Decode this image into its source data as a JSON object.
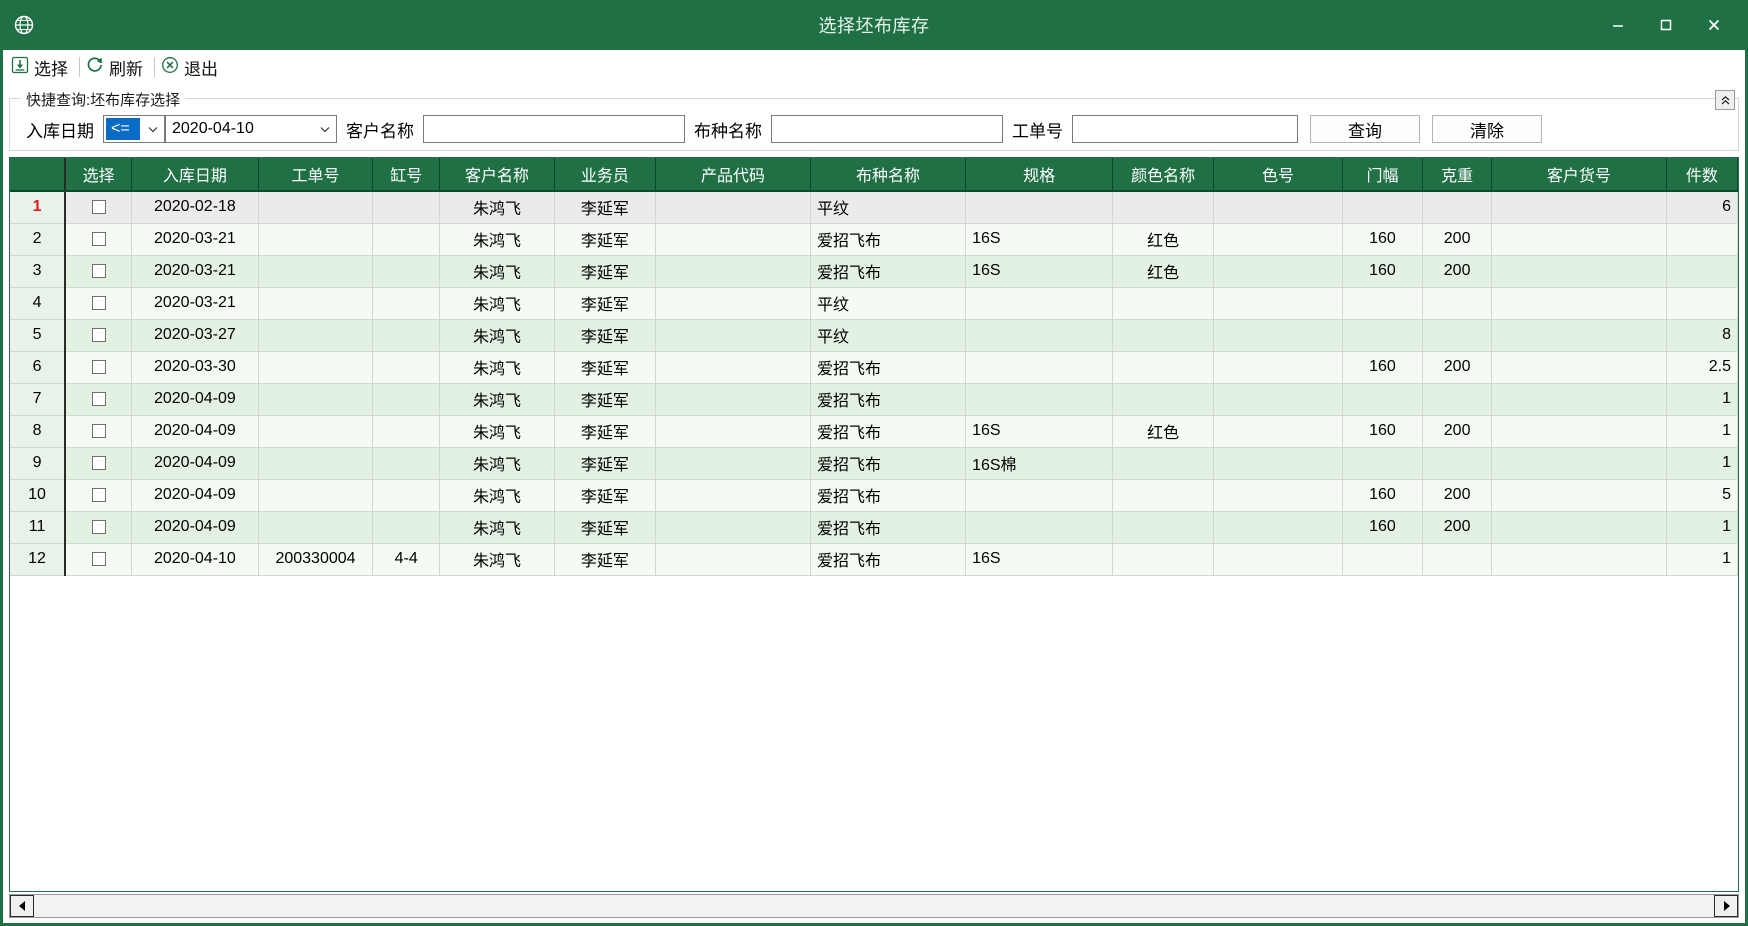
{
  "window": {
    "title": "选择坯布库存",
    "app_icon": "globe-icon",
    "minimize": "–",
    "maximize": "□",
    "close": "✕",
    "accent_color": "#1f7145"
  },
  "toolbar": {
    "items": [
      {
        "label": "选择",
        "icon": "download-box-icon"
      },
      {
        "label": "刷新",
        "icon": "refresh-icon"
      },
      {
        "label": "退出",
        "icon": "close-circle-icon"
      }
    ]
  },
  "query": {
    "group_title": "快捷查询:坯布库存选择",
    "collapse_icon": "chevron-up-icon",
    "date_label": "入库日期",
    "comparator_value": "<=",
    "comparator_options": [
      "<=",
      ">=",
      "=",
      "<",
      ">"
    ],
    "date_value": "2020-04-10",
    "customer_label": "客户名称",
    "customer_value": "",
    "customer_placeholder": "",
    "fabric_label": "布种名称",
    "fabric_value": "",
    "fabric_placeholder": "",
    "order_label": "工单号",
    "order_value": "",
    "order_placeholder": "",
    "search_button": "查询",
    "clear_button": "清除"
  },
  "grid": {
    "row_header": "",
    "columns": [
      "选择",
      "入库日期",
      "工单号",
      "缸号",
      "客户名称",
      "业务员",
      "产品代码",
      "布种名称",
      "规格",
      "颜色名称",
      "色号",
      "门幅",
      "克重",
      "客户货号",
      "件数"
    ],
    "rows": [
      {
        "n": "1",
        "selected": true,
        "checked": false,
        "date": "2020-02-18",
        "order": "",
        "vat": "",
        "customer": "朱鸿飞",
        "sales": "李延军",
        "product": "",
        "fabric": "平纹",
        "spec": "",
        "color": "",
        "colorno": "",
        "width": "",
        "weight": "",
        "custno": "",
        "pieces": "6"
      },
      {
        "n": "2",
        "selected": false,
        "checked": false,
        "date": "2020-03-21",
        "order": "",
        "vat": "",
        "customer": "朱鸿飞",
        "sales": "李延军",
        "product": "",
        "fabric": "爱招飞布",
        "spec": "16S",
        "color": "红色",
        "colorno": "",
        "width": "160",
        "weight": "200",
        "custno": "",
        "pieces": ""
      },
      {
        "n": "3",
        "selected": false,
        "checked": false,
        "date": "2020-03-21",
        "order": "",
        "vat": "",
        "customer": "朱鸿飞",
        "sales": "李延军",
        "product": "",
        "fabric": "爱招飞布",
        "spec": "16S",
        "color": "红色",
        "colorno": "",
        "width": "160",
        "weight": "200",
        "custno": "",
        "pieces": ""
      },
      {
        "n": "4",
        "selected": false,
        "checked": false,
        "date": "2020-03-21",
        "order": "",
        "vat": "",
        "customer": "朱鸿飞",
        "sales": "李延军",
        "product": "",
        "fabric": "平纹",
        "spec": "",
        "color": "",
        "colorno": "",
        "width": "",
        "weight": "",
        "custno": "",
        "pieces": ""
      },
      {
        "n": "5",
        "selected": false,
        "checked": false,
        "date": "2020-03-27",
        "order": "",
        "vat": "",
        "customer": "朱鸿飞",
        "sales": "李延军",
        "product": "",
        "fabric": "平纹",
        "spec": "",
        "color": "",
        "colorno": "",
        "width": "",
        "weight": "",
        "custno": "",
        "pieces": "8"
      },
      {
        "n": "6",
        "selected": false,
        "checked": false,
        "date": "2020-03-30",
        "order": "",
        "vat": "",
        "customer": "朱鸿飞",
        "sales": "李延军",
        "product": "",
        "fabric": "爱招飞布",
        "spec": "",
        "color": "",
        "colorno": "",
        "width": "160",
        "weight": "200",
        "custno": "",
        "pieces": "2.5"
      },
      {
        "n": "7",
        "selected": false,
        "checked": false,
        "date": "2020-04-09",
        "order": "",
        "vat": "",
        "customer": "朱鸿飞",
        "sales": "李延军",
        "product": "",
        "fabric": "爱招飞布",
        "spec": "",
        "color": "",
        "colorno": "",
        "width": "",
        "weight": "",
        "custno": "",
        "pieces": "1"
      },
      {
        "n": "8",
        "selected": false,
        "checked": false,
        "date": "2020-04-09",
        "order": "",
        "vat": "",
        "customer": "朱鸿飞",
        "sales": "李延军",
        "product": "",
        "fabric": "爱招飞布",
        "spec": "16S",
        "color": "红色",
        "colorno": "",
        "width": "160",
        "weight": "200",
        "custno": "",
        "pieces": "1"
      },
      {
        "n": "9",
        "selected": false,
        "checked": false,
        "date": "2020-04-09",
        "order": "",
        "vat": "",
        "customer": "朱鸿飞",
        "sales": "李延军",
        "product": "",
        "fabric": "爱招飞布",
        "spec": "16S棉",
        "color": "",
        "colorno": "",
        "width": "",
        "weight": "",
        "custno": "",
        "pieces": "1"
      },
      {
        "n": "10",
        "selected": false,
        "checked": false,
        "date": "2020-04-09",
        "order": "",
        "vat": "",
        "customer": "朱鸿飞",
        "sales": "李延军",
        "product": "",
        "fabric": "爱招飞布",
        "spec": "",
        "color": "",
        "colorno": "",
        "width": "160",
        "weight": "200",
        "custno": "",
        "pieces": "5"
      },
      {
        "n": "11",
        "selected": false,
        "checked": false,
        "date": "2020-04-09",
        "order": "",
        "vat": "",
        "customer": "朱鸿飞",
        "sales": "李延军",
        "product": "",
        "fabric": "爱招飞布",
        "spec": "",
        "color": "",
        "colorno": "",
        "width": "160",
        "weight": "200",
        "custno": "",
        "pieces": "1"
      },
      {
        "n": "12",
        "selected": false,
        "checked": false,
        "date": "2020-04-10",
        "order": "200330004",
        "vat": "4-4",
        "customer": "朱鸿飞",
        "sales": "李延军",
        "product": "",
        "fabric": "爱招飞布",
        "spec": "16S",
        "color": "",
        "colorno": "",
        "width": "",
        "weight": "",
        "custno": "",
        "pieces": "1"
      }
    ]
  },
  "scrollbar": {
    "left_arrow": "◀",
    "right_arrow": "▶"
  }
}
